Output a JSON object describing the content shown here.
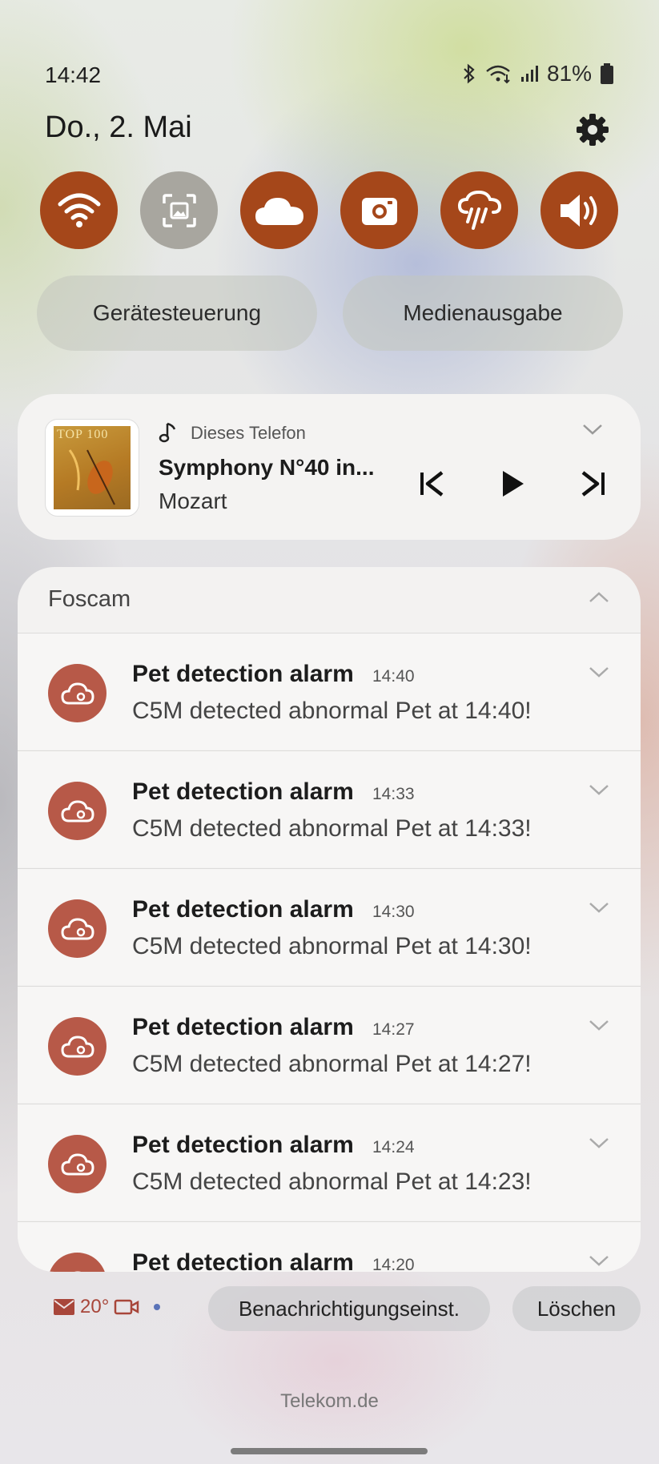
{
  "status": {
    "time": "14:42",
    "battery": "81%"
  },
  "header": {
    "date": "Do., 2. Mai"
  },
  "quick_settings": [
    {
      "icon": "wifi-icon",
      "active": true
    },
    {
      "icon": "screenshot-icon",
      "active": false
    },
    {
      "icon": "cloud-icon",
      "active": true
    },
    {
      "icon": "camera-icon",
      "active": true
    },
    {
      "icon": "weather-rain-icon",
      "active": true
    },
    {
      "icon": "volume-icon",
      "active": true
    }
  ],
  "pills": {
    "device_control": "Gerätesteuerung",
    "media_output": "Medienausgabe"
  },
  "media": {
    "source": "Dieses Telefon",
    "song": "Symphony N°40 in...",
    "artist": "Mozart",
    "album_art_text": "TOP 100"
  },
  "group": {
    "app": "Foscam",
    "notifications": [
      {
        "title": "Pet detection alarm",
        "time": "14:40",
        "body": "C5M detected abnormal Pet at 14:40!"
      },
      {
        "title": "Pet detection alarm",
        "time": "14:33",
        "body": "C5M detected abnormal Pet at 14:33!"
      },
      {
        "title": "Pet detection alarm",
        "time": "14:30",
        "body": "C5M detected abnormal Pet at 14:30!"
      },
      {
        "title": "Pet detection alarm",
        "time": "14:27",
        "body": "C5M detected abnormal Pet at 14:27!"
      },
      {
        "title": "Pet detection alarm",
        "time": "14:24",
        "body": "C5M detected abnormal Pet at 14:23!"
      },
      {
        "title": "Pet detection alarm",
        "time": "14:20",
        "body": ""
      }
    ]
  },
  "footer": {
    "temperature": "20°",
    "settings_button": "Benachrichtigungseinst.",
    "clear_button": "Löschen",
    "carrier": "Telekom.de"
  },
  "colors": {
    "accent": "#a5471a",
    "notif_icon": "#b75948"
  }
}
